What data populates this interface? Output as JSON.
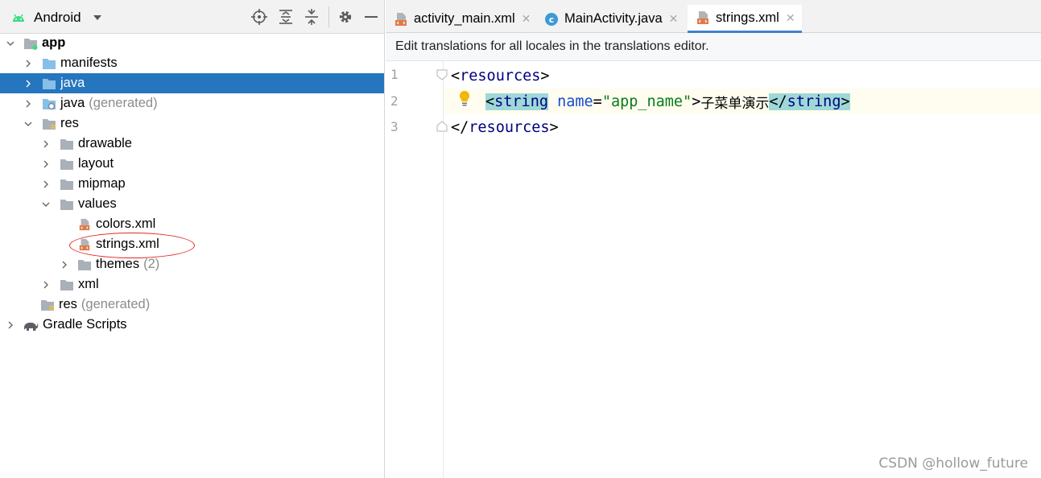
{
  "project_panel": {
    "view_selector": {
      "label": "Android",
      "icon": "android-icon"
    },
    "header_icons": [
      "locate-icon",
      "expand-all-icon",
      "collapse-all-icon",
      "gear-icon",
      "minimize-icon"
    ],
    "tree": [
      {
        "label": "app",
        "extra": "",
        "icon": "module-folder-icon",
        "expanded": true,
        "selected": false
      },
      {
        "label": "manifests",
        "extra": "",
        "icon": "folder-icon",
        "expanded": false,
        "selected": false
      },
      {
        "label": "java",
        "extra": "",
        "icon": "folder-icon",
        "expanded": false,
        "selected": true
      },
      {
        "label": "java",
        "extra": "(generated)",
        "icon": "generated-folder-icon",
        "expanded": false,
        "selected": false
      },
      {
        "label": "res",
        "extra": "",
        "icon": "res-folder-icon",
        "expanded": true,
        "selected": false
      },
      {
        "label": "drawable",
        "extra": "",
        "icon": "folder-icon",
        "expanded": false,
        "selected": false
      },
      {
        "label": "layout",
        "extra": "",
        "icon": "folder-icon",
        "expanded": false,
        "selected": false
      },
      {
        "label": "mipmap",
        "extra": "",
        "icon": "folder-icon",
        "expanded": false,
        "selected": false
      },
      {
        "label": "values",
        "extra": "",
        "icon": "folder-icon",
        "expanded": true,
        "selected": false
      },
      {
        "label": "colors.xml",
        "extra": "",
        "icon": "xml-file-icon",
        "expanded": null,
        "selected": false
      },
      {
        "label": "strings.xml",
        "extra": "",
        "icon": "xml-file-icon",
        "expanded": null,
        "selected": false
      },
      {
        "label": "themes",
        "extra": "(2)",
        "icon": "folder-icon",
        "expanded": false,
        "selected": false
      },
      {
        "label": "xml",
        "extra": "",
        "icon": "folder-icon",
        "expanded": false,
        "selected": false
      },
      {
        "label": "res",
        "extra": "(generated)",
        "icon": "res-folder-icon",
        "expanded": null,
        "selected": false
      },
      {
        "label": "Gradle Scripts",
        "extra": "",
        "icon": "gradle-elephant-icon",
        "expanded": false,
        "selected": false
      }
    ]
  },
  "editor": {
    "tabs": [
      {
        "label": "activity_main.xml",
        "icon": "xml-file-icon",
        "active": false
      },
      {
        "label": "MainActivity.java",
        "icon": "java-class-icon",
        "active": false
      },
      {
        "label": "strings.xml",
        "icon": "xml-file-icon",
        "active": true
      }
    ],
    "banner": "Edit translations for all locales in the translations editor.",
    "line_numbers": [
      "1",
      "2",
      "3"
    ],
    "code": {
      "line1": {
        "open": "<",
        "tag": "resources",
        "close": ">"
      },
      "line2": {
        "open": "<",
        "tag": "string",
        "attr": "name",
        "eq": "=",
        "value": "\"app_name\"",
        "gt": ">",
        "text": "子菜单演示",
        "end_open": "</",
        "end_tag": "string",
        "end_close": ">"
      },
      "line3": {
        "open": "</",
        "tag": "resources",
        "close": ">"
      }
    }
  },
  "watermark": "CSDN @hollow_future",
  "colors": {
    "selection": "#2675bf",
    "tag": "#000080",
    "attr": "#174ad4",
    "value": "#067d17",
    "match_highlight": "#9ed8d8",
    "annotation": "#e0281e"
  }
}
